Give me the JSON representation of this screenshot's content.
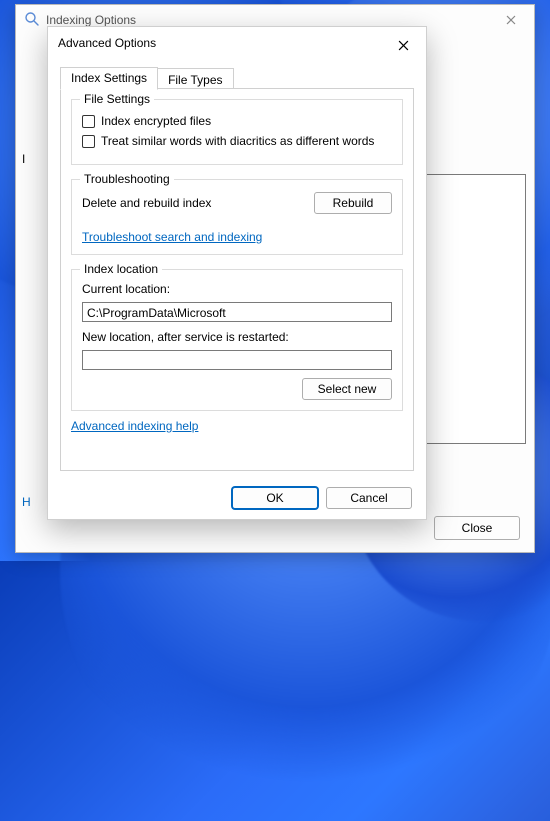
{
  "parent": {
    "title": "Indexing Options",
    "body_letter": "I",
    "link_letter": "H",
    "close_button": "Close"
  },
  "dialog": {
    "title": "Advanced Options",
    "tabs": {
      "index_settings": "Index Settings",
      "file_types": "File Types"
    },
    "file_settings": {
      "group": "File Settings",
      "encrypt": "Index encrypted files",
      "diacritics": "Treat similar words with diacritics as different words"
    },
    "troubleshooting": {
      "group": "Troubleshooting",
      "text": "Delete and rebuild index",
      "rebuild": "Rebuild",
      "link": "Troubleshoot search and indexing"
    },
    "index_location": {
      "group": "Index location",
      "current_label": "Current location:",
      "current_path": "C:\\ProgramData\\Microsoft",
      "new_label": "New location, after service is restarted:",
      "new_path": "",
      "select_new": "Select new"
    },
    "help_link": "Advanced indexing help",
    "ok": "OK",
    "cancel": "Cancel"
  }
}
